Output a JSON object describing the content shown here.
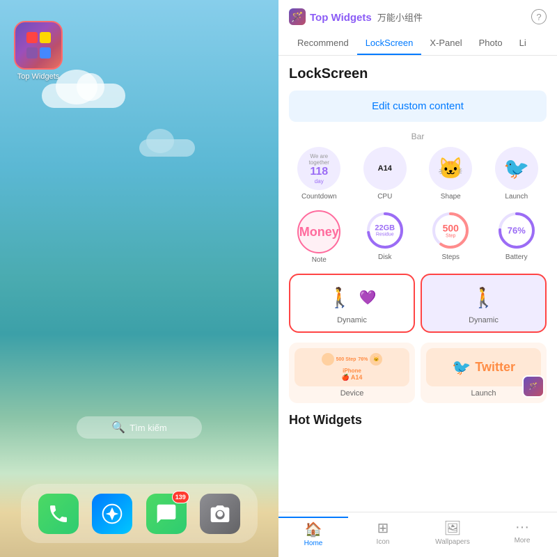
{
  "left": {
    "app_icon_label": "Top Widgets",
    "search_placeholder": "Tìm kiếm",
    "dock": {
      "items": [
        "Phone",
        "Safari",
        "Messages",
        "Camera"
      ],
      "badge_count": "139"
    }
  },
  "right": {
    "header": {
      "title": "Top Widgets",
      "subtitle": "万能小组件",
      "help_label": "?"
    },
    "nav_tabs": [
      "Recommend",
      "LockScreen",
      "X-Panel",
      "Photo",
      "Li"
    ],
    "active_tab": "LockScreen",
    "section_lockscreen": "LockScreen",
    "edit_button_label": "Edit custom content",
    "bar_label": "Bar",
    "widgets_row1": [
      {
        "label": "Countdown",
        "top": "We are together",
        "num": "118",
        "unit": "day"
      },
      {
        "label": "CPU",
        "symbol": "",
        "text": "A14"
      },
      {
        "label": "Shape"
      },
      {
        "label": "Launch"
      }
    ],
    "widgets_row2": [
      {
        "label": "Note",
        "text": "Money"
      },
      {
        "label": "Disk",
        "num": "22GB",
        "sub": "Residue"
      },
      {
        "label": "Steps",
        "num": "500",
        "unit": "Step"
      },
      {
        "label": "Battery",
        "num": "76%"
      }
    ],
    "dynamic_label": "Dynamic",
    "preview_row": [
      {
        "label": "Device"
      },
      {
        "label": "Launch",
        "twitter": "Twitter"
      }
    ],
    "hot_widgets_title": "Hot Widgets",
    "bottom_nav": [
      {
        "label": "Home",
        "active": true
      },
      {
        "label": "Icon",
        "active": false
      },
      {
        "label": "Wallpapers",
        "active": false
      },
      {
        "label": "More",
        "active": false
      }
    ]
  }
}
